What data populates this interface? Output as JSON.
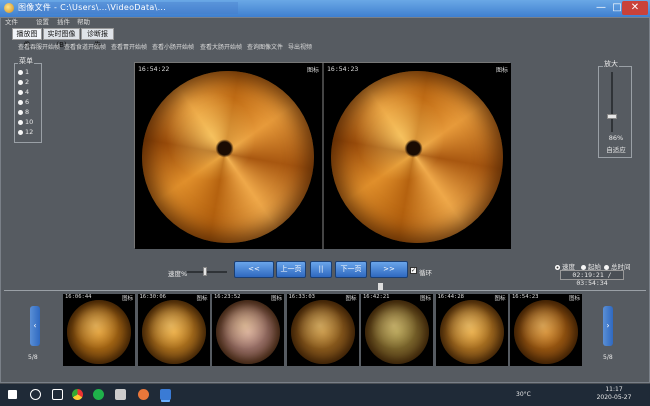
{
  "window": {
    "title": "图像文件 - C:\\Users\\...\\VideoData\\...",
    "min": "—",
    "max": "□",
    "close": "✕"
  },
  "menu": [
    "文件",
    "设置",
    "插件",
    "帮助"
  ],
  "tabs": [
    "播放图像",
    "实时图像 (B)",
    "诊断报告"
  ],
  "toolbar": [
    "查看吞服开始帧",
    "查看食道开始帧",
    "查看胃开始帧",
    "查看小肠开始帧",
    "查看大肠开始帧",
    "查询图像文件",
    "导出视频"
  ],
  "left_panel": {
    "title": "菜单",
    "options": [
      "1",
      "2",
      "4",
      "6",
      "8",
      "10",
      "12"
    ]
  },
  "viewer": {
    "left": {
      "timestamp": "16:54:22",
      "tag": "图标"
    },
    "right": {
      "timestamp": "16:54:23",
      "tag": "图标"
    }
  },
  "zoom": {
    "title": "放大",
    "percent": "86%",
    "fit": "自适应",
    "level": 0.3
  },
  "playback": {
    "speed_label": "速度%",
    "speed_level": 0.4,
    "buttons": [
      "<<",
      "上一页",
      "||",
      "下一页",
      ">>"
    ],
    "loop_label": "循环",
    "loop_checked": true,
    "modes": [
      "速度",
      "起始",
      "总时间"
    ],
    "mode_selected": 0,
    "time": "02:19:21 / 03:54:34"
  },
  "thumbnails": [
    {
      "timestamp": "16:06:44",
      "tag": "图标",
      "color": "#d88a1c"
    },
    {
      "timestamp": "16:30:06",
      "tag": "图标",
      "color": "#e39a2a"
    },
    {
      "timestamp": "16:23:52",
      "tag": "图标",
      "color": "#c89a9a"
    },
    {
      "timestamp": "16:33:03",
      "tag": "图标",
      "color": "#b27a2a"
    },
    {
      "timestamp": "16:42:21",
      "tag": "图标",
      "color": "#9a8a40"
    },
    {
      "timestamp": "16:44:28",
      "tag": "图标",
      "color": "#e09a30"
    },
    {
      "timestamp": "16:54:23",
      "tag": "图标",
      "color": "#c77418"
    }
  ],
  "pager": {
    "left": "5/8",
    "right": "5/8",
    "prev": "‹",
    "next": "›"
  },
  "taskbar": {
    "weather": "30°C",
    "time": "11:17",
    "date": "2020-05-27"
  }
}
